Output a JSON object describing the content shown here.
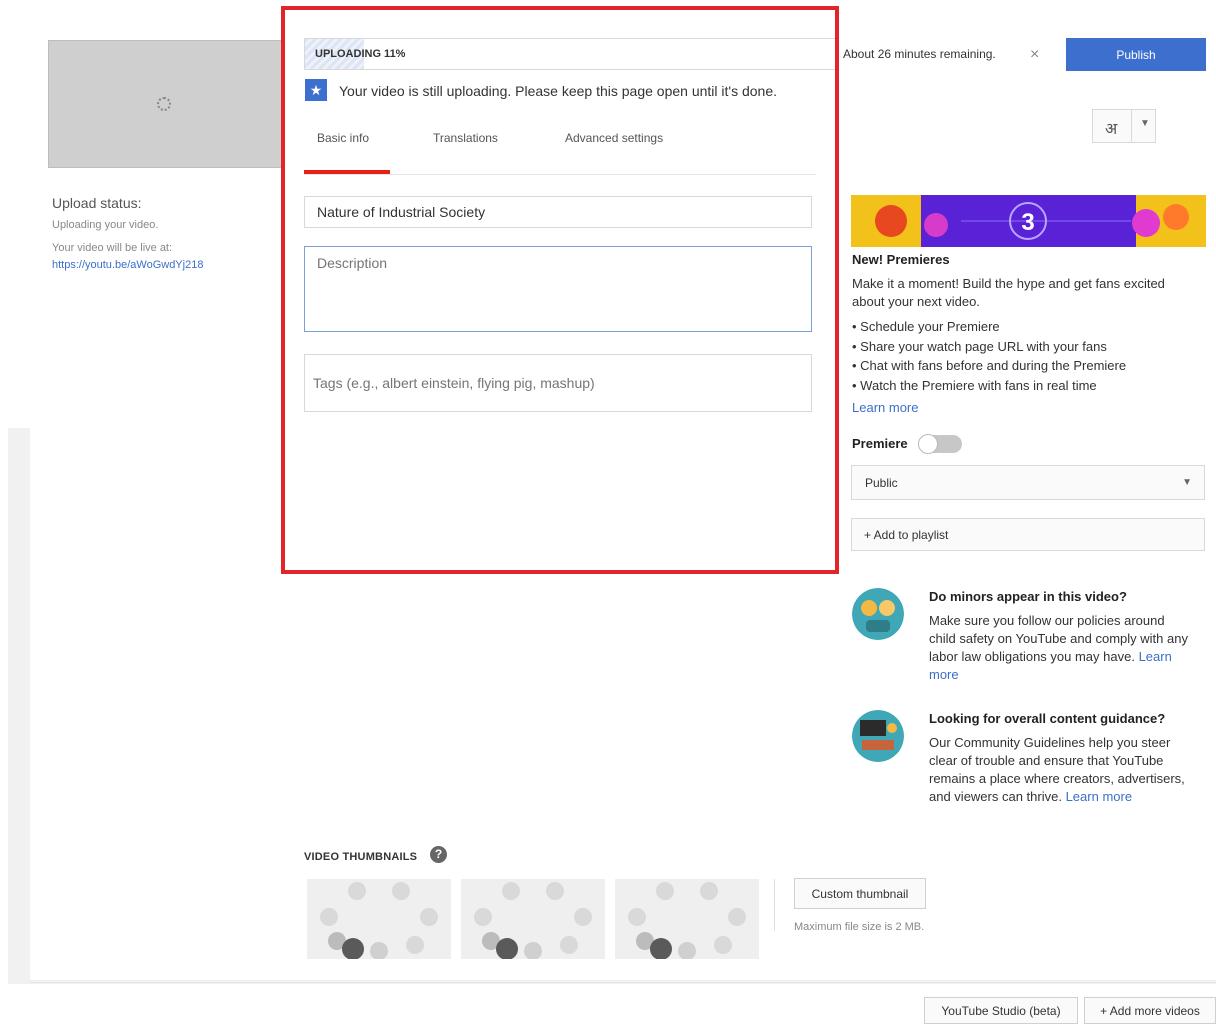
{
  "upload": {
    "progress_label": "UPLOADING 11%",
    "progress_fraction": 0.11,
    "time_remaining": "About 26 minutes remaining.",
    "close_icon": "×",
    "publish_label": "Publish",
    "language_glyph": "अ",
    "notice_icon": "★",
    "notice_text": "Your video is still uploading. Please keep this page open until it's done.",
    "status_title": "Upload status:",
    "status_sub": "Uploading your video.",
    "live_label": "Your video will be live at:",
    "live_url": "https://youtu.be/aWoGwdYj218"
  },
  "tabs": [
    "Basic info",
    "Translations",
    "Advanced settings"
  ],
  "form": {
    "title_value": "Nature of Industrial Society",
    "description_placeholder": "Description",
    "tags_placeholder": "Tags (e.g., albert einstein, flying pig, mashup)"
  },
  "premieres": {
    "banner_number": "3",
    "title": "New! Premieres",
    "description": "Make it a moment! Build the hype and get fans excited about your next video.",
    "bullets": [
      "Schedule your Premiere",
      "Share your watch page URL with your fans",
      "Chat with fans before and during the Premiere",
      "Watch the Premiere with fans in real time"
    ],
    "learn_more": "Learn more",
    "toggle_label": "Premiere",
    "toggle_on": false
  },
  "visibility": {
    "selected": "Public",
    "add_playlist": "+ Add to playlist"
  },
  "info_cards": [
    {
      "title": "Do minors appear in this video?",
      "body": "Make sure you follow our policies around child safety on YouTube and comply with any labor law obligations you may have.",
      "link": "Learn more"
    },
    {
      "title": "Looking for overall content guidance?",
      "body": "Our Community Guidelines help you steer clear of trouble and ensure that YouTube remains a place where creators, advertisers, and viewers can thrive.",
      "link": "Learn more"
    }
  ],
  "thumbnails": {
    "label": "VIDEO THUMBNAILS",
    "help_icon": "?",
    "custom_button": "Custom thumbnail",
    "max_size": "Maximum file size is 2 MB."
  },
  "footer": {
    "studio_button": "YouTube Studio (beta)",
    "add_more": "+ Add more videos"
  },
  "colors": {
    "accent": "#3d6fcf",
    "highlight_box": "#e2252b",
    "tab_active": "#e62117"
  }
}
